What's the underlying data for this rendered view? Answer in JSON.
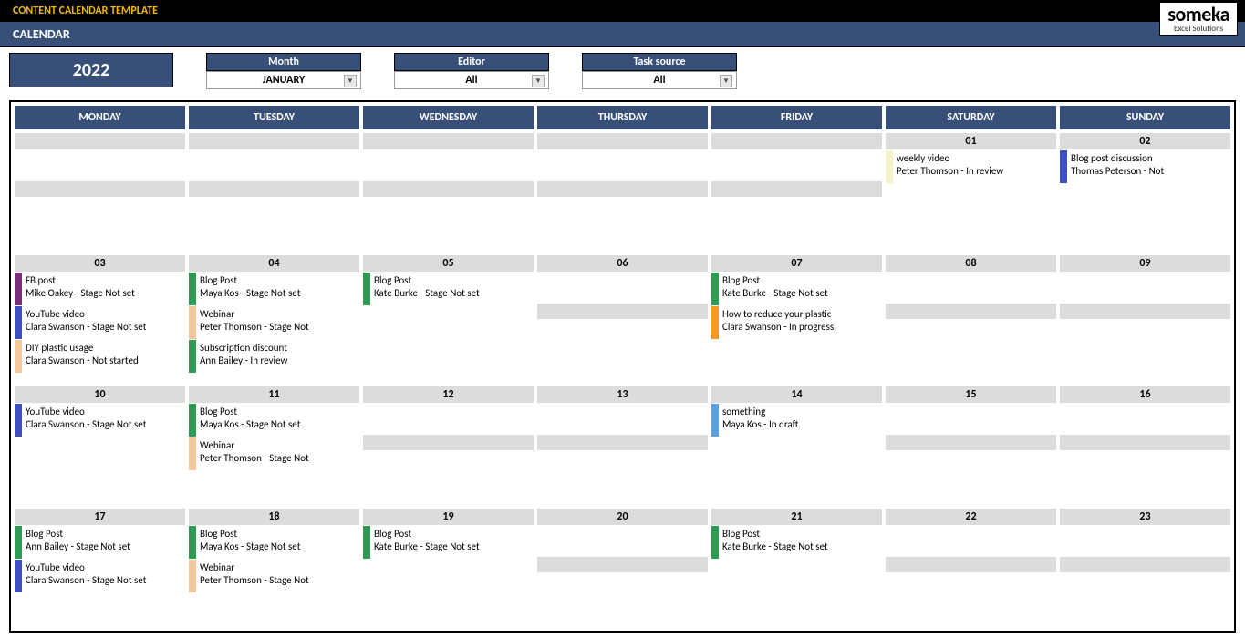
{
  "header": {
    "app_title": "CONTENT CALENDAR TEMPLATE",
    "section_title": "CALENDAR",
    "logo_brand": "someka",
    "logo_sub": "Excel Solutions"
  },
  "filters": {
    "year": "2022",
    "month": {
      "label": "Month",
      "value": "JANUARY"
    },
    "editor": {
      "label": "Editor",
      "value": "All"
    },
    "source": {
      "label": "Task source",
      "value": "All"
    }
  },
  "colors": {
    "green": "#2e9b52",
    "peach": "#f4c89a",
    "purple": "#7a2e7a",
    "blue": "#3c4ec0",
    "lightblue": "#5aa0e0",
    "orange": "#f59a23",
    "cream": "#f5f3c8"
  },
  "day_names": [
    "MONDAY",
    "TUESDAY",
    "WEDNESDAY",
    "THURSDAY",
    "FRIDAY",
    "SATURDAY",
    "SUNDAY"
  ],
  "weeks": [
    [
      {
        "num": "",
        "tasks": []
      },
      {
        "num": "",
        "tasks": []
      },
      {
        "num": "",
        "tasks": []
      },
      {
        "num": "",
        "tasks": []
      },
      {
        "num": "",
        "tasks": []
      },
      {
        "num": "01",
        "tasks": [
          {
            "c": "cream",
            "t": "weekly video",
            "m": "Peter Thomson - In review"
          }
        ]
      },
      {
        "num": "02",
        "tasks": [
          {
            "c": "blue",
            "t": "Blog post discussion",
            "m": "Thomas Peterson - Not"
          }
        ]
      }
    ],
    [
      {
        "num": "03",
        "tasks": [
          {
            "c": "purple",
            "t": "FB post",
            "m": "Mike Oakey - Stage Not set"
          },
          {
            "c": "blue",
            "t": "YouTube video",
            "m": "Clara Swanson - Stage Not set"
          },
          {
            "c": "peach",
            "t": "DIY plastic usage",
            "m": "Clara Swanson - Not started"
          }
        ]
      },
      {
        "num": "04",
        "tasks": [
          {
            "c": "green",
            "t": "Blog Post",
            "m": "Maya Kos - Stage Not set"
          },
          {
            "c": "peach",
            "t": "Webinar",
            "m": "Peter Thomson - Stage Not"
          },
          {
            "c": "green",
            "t": "Subscription discount",
            "m": "Ann Bailey - In review"
          }
        ]
      },
      {
        "num": "05",
        "tasks": [
          {
            "c": "green",
            "t": "Blog Post",
            "m": "Kate Burke - Stage Not set"
          }
        ]
      },
      {
        "num": "06",
        "tasks": []
      },
      {
        "num": "07",
        "tasks": [
          {
            "c": "green",
            "t": "Blog Post",
            "m": "Kate Burke - Stage Not set"
          },
          {
            "c": "orange",
            "t": "How to reduce your plastic",
            "m": "Clara Swanson - In progress"
          }
        ]
      },
      {
        "num": "08",
        "tasks": []
      },
      {
        "num": "09",
        "tasks": []
      }
    ],
    [
      {
        "num": "10",
        "tasks": [
          {
            "c": "blue",
            "t": "YouTube video",
            "m": "Clara Swanson - Stage Not set"
          }
        ]
      },
      {
        "num": "11",
        "tasks": [
          {
            "c": "green",
            "t": "Blog Post",
            "m": "Maya Kos - Stage Not set"
          },
          {
            "c": "peach",
            "t": "Webinar",
            "m": "Peter Thomson - Stage Not"
          }
        ]
      },
      {
        "num": "12",
        "tasks": []
      },
      {
        "num": "13",
        "tasks": []
      },
      {
        "num": "14",
        "tasks": [
          {
            "c": "lightblue",
            "t": "something",
            "m": "Maya Kos - In draft"
          }
        ]
      },
      {
        "num": "15",
        "tasks": []
      },
      {
        "num": "16",
        "tasks": []
      }
    ],
    [
      {
        "num": "17",
        "tasks": [
          {
            "c": "green",
            "t": "Blog Post",
            "m": "Ann Bailey - Stage Not set"
          },
          {
            "c": "blue",
            "t": "YouTube video",
            "m": "Clara Swanson - Stage Not set"
          }
        ]
      },
      {
        "num": "18",
        "tasks": [
          {
            "c": "green",
            "t": "Blog Post",
            "m": "Maya Kos - Stage Not set"
          },
          {
            "c": "peach",
            "t": "Webinar",
            "m": "Peter Thomson - Stage Not"
          }
        ]
      },
      {
        "num": "19",
        "tasks": [
          {
            "c": "green",
            "t": "Blog Post",
            "m": "Kate Burke - Stage Not set"
          }
        ]
      },
      {
        "num": "20",
        "tasks": []
      },
      {
        "num": "21",
        "tasks": [
          {
            "c": "green",
            "t": "Blog Post",
            "m": "Kate Burke - Stage Not set"
          }
        ]
      },
      {
        "num": "22",
        "tasks": []
      },
      {
        "num": "23",
        "tasks": []
      }
    ]
  ]
}
